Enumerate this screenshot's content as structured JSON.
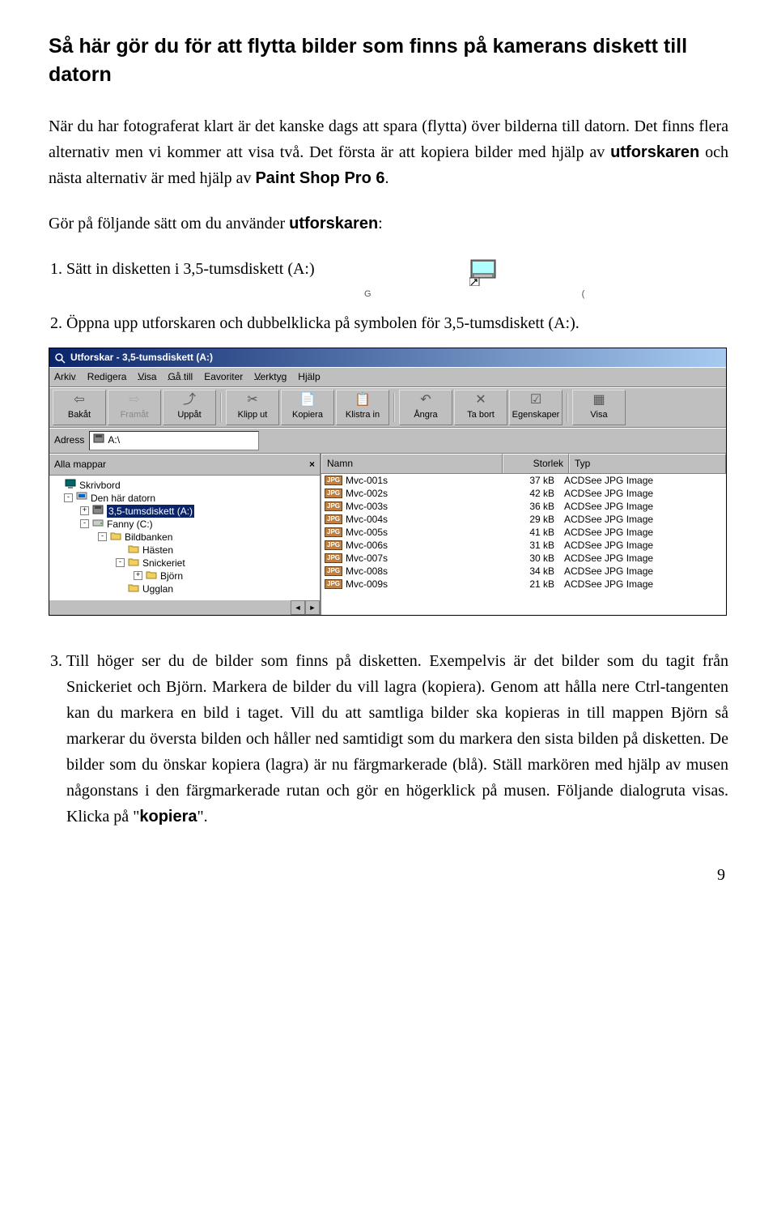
{
  "heading": "Så här gör du för att flytta bilder som finns på kamerans diskett till datorn",
  "intro_before_bold1": "När du har fotograferat klart är det kanske dags att spara (flytta) över bilderna till datorn. Det finns flera alternativ men vi kommer att visa två. Det första är att kopiera bilder med hjälp av ",
  "bold1": "utforskaren",
  "intro_mid": " och nästa alternativ är med hjälp av ",
  "bold2": "Paint Shop Pro 6",
  "intro_after_bold2": ".",
  "subintro_before": "Gör på följande sätt om du använder ",
  "subintro_bold": "utforskaren",
  "subintro_after": ":",
  "step1": "Sätt in disketten i 3,5-tumsdiskett (A:)",
  "label_left_crop": "G",
  "label_right_crop": "(",
  "step2": "Öppna upp utforskaren och dubbelklicka på symbolen för 3,5-tumsdiskett (A:).",
  "step3_p1": "Till höger ser du de bilder som finns på disketten. Exempelvis är det bilder som du tagit från Snickeriet och Björn. Markera de bilder du vill lagra (kopiera). Genom att hålla nere Ctrl-tangenten kan du markera en bild i taget. Vill du att samtliga bilder ska kopieras in till mappen Björn så markerar du översta bilden och håller ned samtidigt som du markera den sista bilden på disketten. De bilder som du önskar kopiera (lagra) är nu färgmarkerade (blå). Ställ markören med hjälp av musen någonstans i den färgmarkerade rutan och gör en högerklick på musen. Följande dialogruta visas. Klicka på \"",
  "step3_kopiera": "kopiera",
  "step3_p2": "\".",
  "explorer": {
    "title": "Utforskar - 3,5-tumsdiskett (A:)",
    "menus": [
      "Arkiv",
      "Redigera",
      "Visa",
      "Gå till",
      "Eavoriter",
      "Verktyg",
      "Hjälp"
    ],
    "toolbar": [
      {
        "label": "Bakåt",
        "glyph": "⇦",
        "disabled": false
      },
      {
        "label": "Framåt",
        "glyph": "⇨",
        "disabled": true
      },
      {
        "label": "Uppåt",
        "glyph": "⤴",
        "disabled": false
      },
      {
        "label": "Klipp ut",
        "glyph": "✂",
        "disabled": false
      },
      {
        "label": "Kopiera",
        "glyph": "📄",
        "disabled": false
      },
      {
        "label": "Klistra in",
        "glyph": "📋",
        "disabled": false
      },
      {
        "label": "Ångra",
        "glyph": "↶",
        "disabled": false
      },
      {
        "label": "Ta bort",
        "glyph": "✕",
        "disabled": false
      },
      {
        "label": "Egenskaper",
        "glyph": "☑",
        "disabled": false
      },
      {
        "label": "Visa",
        "glyph": "▦",
        "disabled": false
      }
    ],
    "address_label": "Adress",
    "address_value": "A:\\",
    "tree_header": "Alla mappar",
    "tree": [
      {
        "indent": 0,
        "toggle": null,
        "icon": "desktop",
        "label": "Skrivbord"
      },
      {
        "indent": 1,
        "toggle": "-",
        "icon": "computer",
        "label": "Den här datorn"
      },
      {
        "indent": 2,
        "toggle": "+",
        "icon": "floppy",
        "label": "3,5-tumsdiskett (A:)",
        "selected": true
      },
      {
        "indent": 2,
        "toggle": "-",
        "icon": "drive",
        "label": "Fanny (C:)"
      },
      {
        "indent": 3,
        "toggle": "-",
        "icon": "folder",
        "label": "Bildbanken"
      },
      {
        "indent": 4,
        "toggle": null,
        "icon": "folder",
        "label": "Hästen"
      },
      {
        "indent": 4,
        "toggle": "-",
        "icon": "folder",
        "label": "Snickeriet"
      },
      {
        "indent": 4,
        "toggle": "+",
        "icon": "folder",
        "label": "Björn",
        "extra_indent": true
      },
      {
        "indent": 4,
        "toggle": null,
        "icon": "folder",
        "label": "Ugglan"
      }
    ],
    "cols": {
      "name": "Namn",
      "size": "Storlek",
      "type": "Typ"
    },
    "files": [
      {
        "name": "Mvc-001s",
        "size": "37 kB",
        "type": "ACDSee JPG Image"
      },
      {
        "name": "Mvc-002s",
        "size": "42 kB",
        "type": "ACDSee JPG Image"
      },
      {
        "name": "Mvc-003s",
        "size": "36 kB",
        "type": "ACDSee JPG Image"
      },
      {
        "name": "Mvc-004s",
        "size": "29 kB",
        "type": "ACDSee JPG Image"
      },
      {
        "name": "Mvc-005s",
        "size": "41 kB",
        "type": "ACDSee JPG Image"
      },
      {
        "name": "Mvc-006s",
        "size": "31 kB",
        "type": "ACDSee JPG Image"
      },
      {
        "name": "Mvc-007s",
        "size": "30 kB",
        "type": "ACDSee JPG Image"
      },
      {
        "name": "Mvc-008s",
        "size": "34 kB",
        "type": "ACDSee JPG Image"
      },
      {
        "name": "Mvc-009s",
        "size": "21 kB",
        "type": "ACDSee JPG Image"
      }
    ]
  },
  "page_number": "9"
}
